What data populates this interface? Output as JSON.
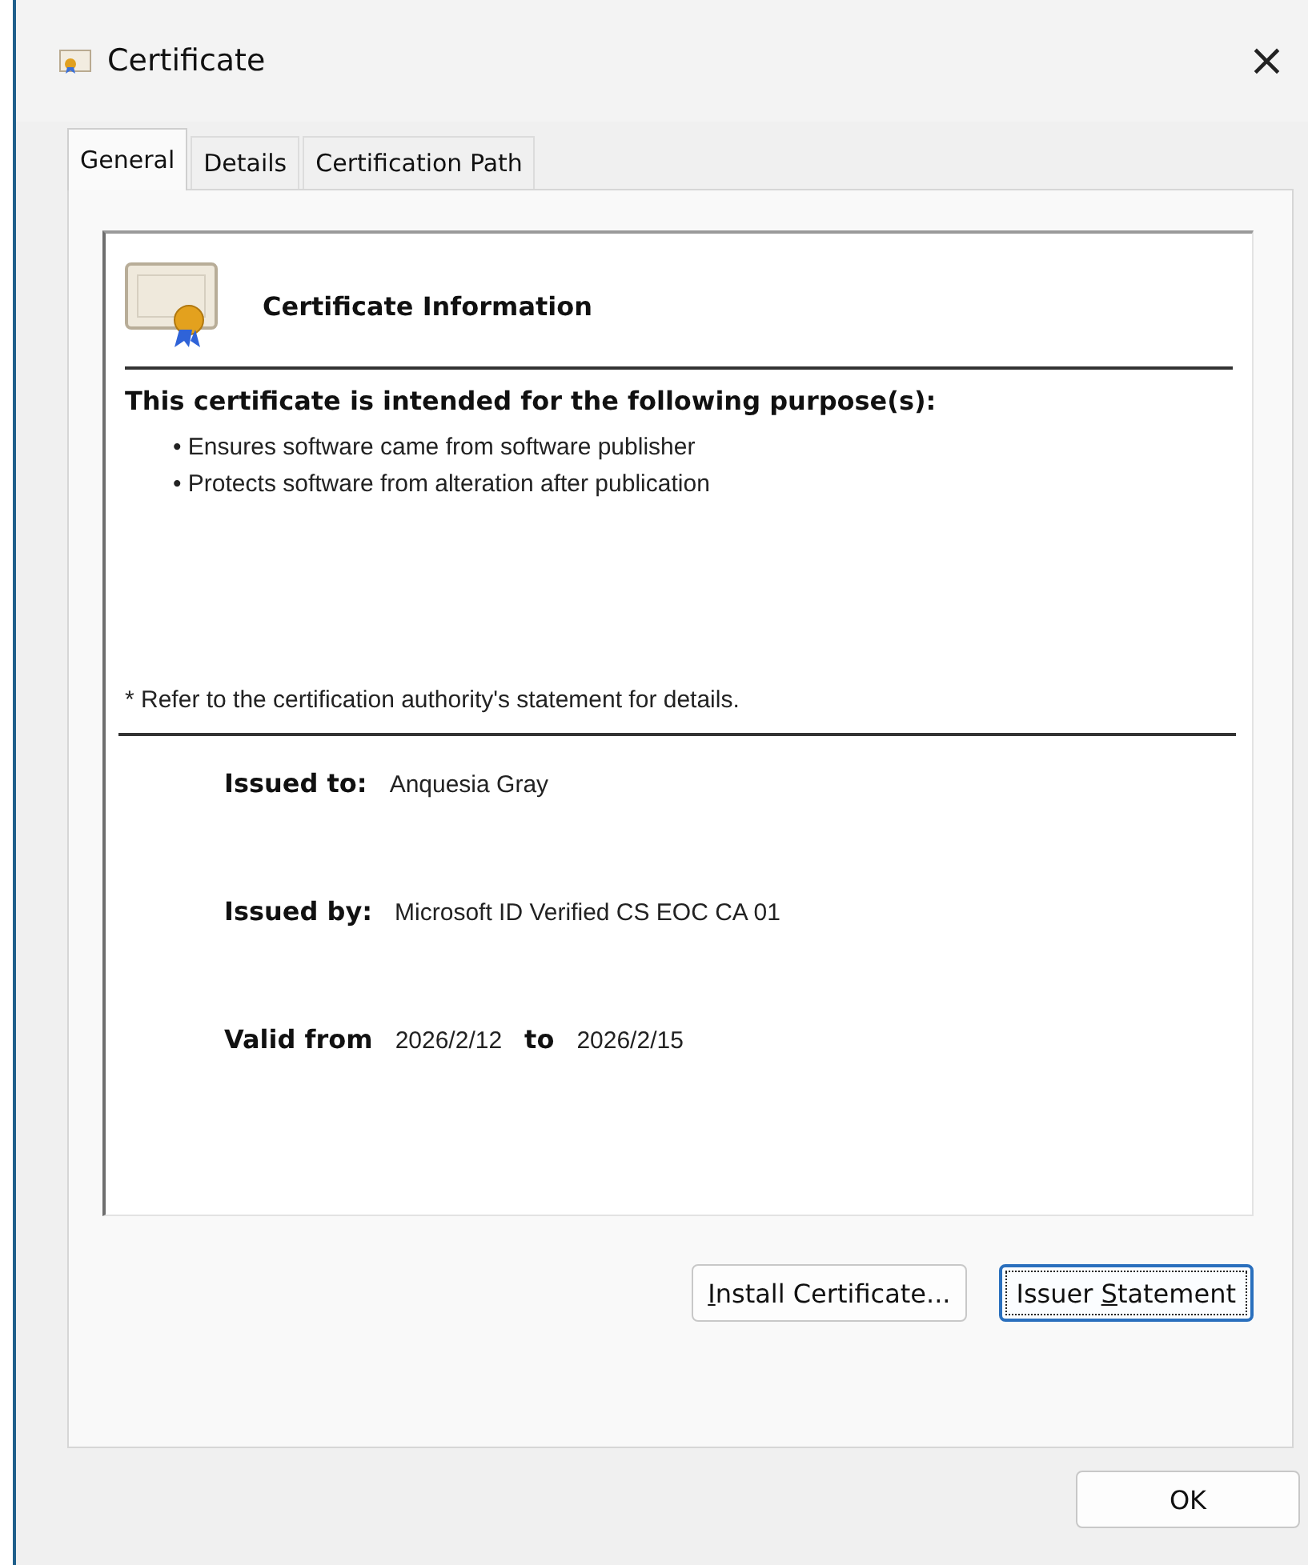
{
  "window": {
    "title": "Certificate",
    "close": "×"
  },
  "tabs": [
    {
      "label": "General",
      "selected": true
    },
    {
      "label": "Details",
      "selected": false
    },
    {
      "label": "Certification Path",
      "selected": false
    }
  ],
  "info": {
    "heading": "Certificate Information",
    "purpose_heading": "This certificate is intended for the following purpose(s):",
    "purposes": [
      "• Ensures software came from software publisher",
      "• Protects software from alteration after publication"
    ],
    "note": "* Refer to the certification authority's statement for details.",
    "issued_to": {
      "label": "Issued to:",
      "value": "Anquesia Gray"
    },
    "issued_by": {
      "label": "Issued by:",
      "value": "Microsoft ID Verified CS EOC CA 01"
    },
    "validity": {
      "label": "Valid from",
      "from": "2026/2/12",
      "to_label": "to",
      "to": "2026/2/15"
    }
  },
  "buttons": [
    {
      "label_runs": [
        {
          "text": "I",
          "underlined": true
        },
        {
          "text": "nstall Certificate...",
          "underlined": false
        }
      ],
      "focused": false
    },
    {
      "label_runs": [
        {
          "text": "Issuer ",
          "underlined": false
        },
        {
          "text": "S",
          "underlined": true
        },
        {
          "text": "tatement",
          "underlined": false
        }
      ],
      "focused": true
    }
  ],
  "ok_button": {
    "label": "OK"
  }
}
